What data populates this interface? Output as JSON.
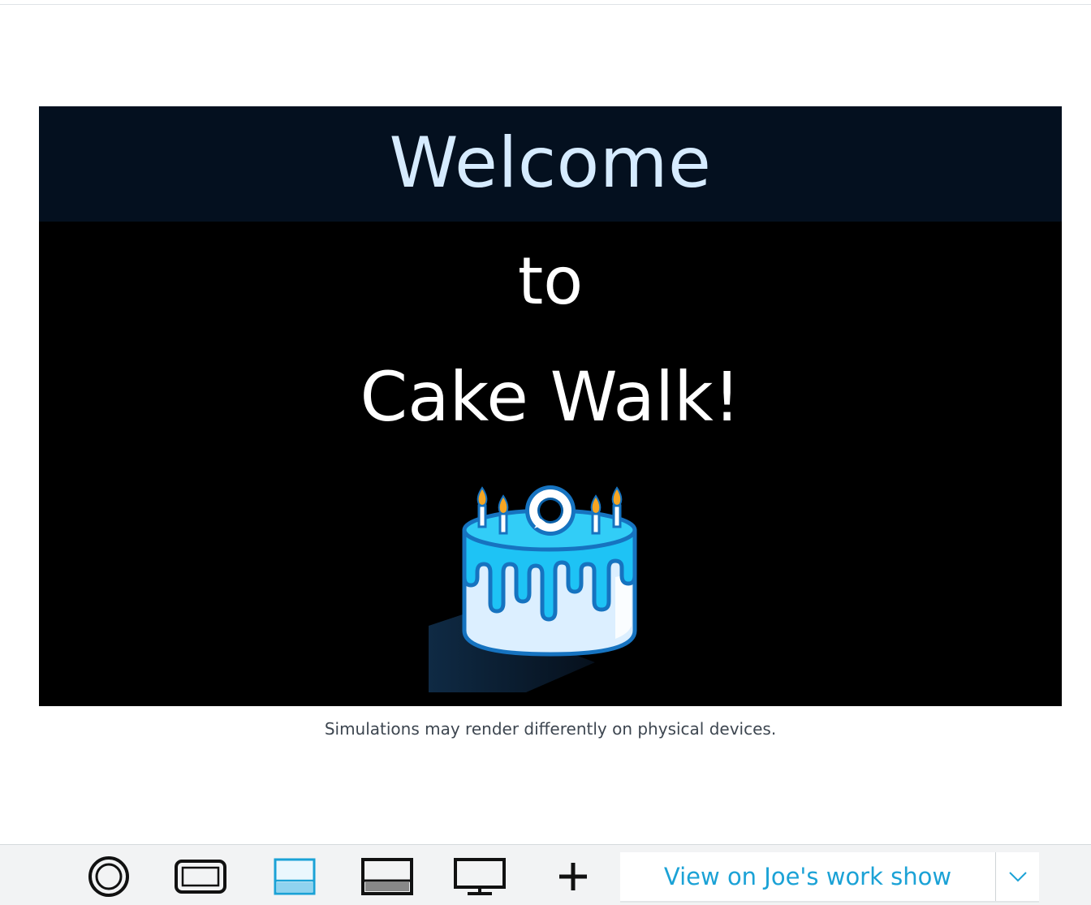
{
  "screen": {
    "title_line1": "Welcome",
    "title_line2": "to",
    "title_line3": "Cake Walk!",
    "image": "birthday-cake-with-alexa-logo"
  },
  "disclaimer": "Simulations may render differently on physical devices.",
  "toolbar": {
    "devices": [
      {
        "name": "echo-spot-round-device",
        "selected": false
      },
      {
        "name": "echo-show-medium-device",
        "selected": false
      },
      {
        "name": "echo-show-large-device",
        "selected": true
      },
      {
        "name": "echo-show-xlarge-device",
        "selected": false
      },
      {
        "name": "tv-device",
        "selected": false
      },
      {
        "name": "add-device",
        "selected": false
      }
    ],
    "view_button_label": "View on Joe's work show",
    "dropdown_icon": "chevron-down-icon"
  },
  "colors": {
    "accent": "#1ba2d6",
    "header_band": "#04101f",
    "welcome_text": "#d6ebff",
    "cake_blue": "#1ec3f5"
  }
}
